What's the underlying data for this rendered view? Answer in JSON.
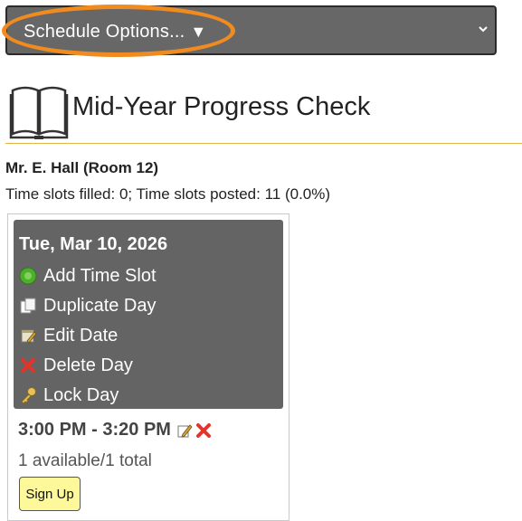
{
  "schedule_options": {
    "label": "Schedule Options...",
    "caret": "▼"
  },
  "page": {
    "title": "Mid-Year Progress Check",
    "teacher": "Mr. E. Hall (Room 12)",
    "slots_summary": "Time slots filled: 0; Time slots posted: 11 (0.0%)"
  },
  "day": {
    "date": "Tue, Mar 10, 2026",
    "menu": [
      {
        "label": "Add Time Slot",
        "icon": "add-circle-icon"
      },
      {
        "label": "Duplicate Day",
        "icon": "duplicate-icon"
      },
      {
        "label": "Edit Date",
        "icon": "calendar-edit-icon"
      },
      {
        "label": "Delete Day",
        "icon": "delete-x-icon"
      },
      {
        "label": "Lock Day",
        "icon": "key-icon"
      }
    ],
    "slot": {
      "time": "3:00 PM - 3:20 PM",
      "availability": "1 available/1 total",
      "signup_label": "Sign Up"
    }
  },
  "colors": {
    "menu_bg": "#646464",
    "highlight_ring": "#f08b1f",
    "signup_bg": "#fdf99a",
    "rule": "#e1b54a"
  }
}
